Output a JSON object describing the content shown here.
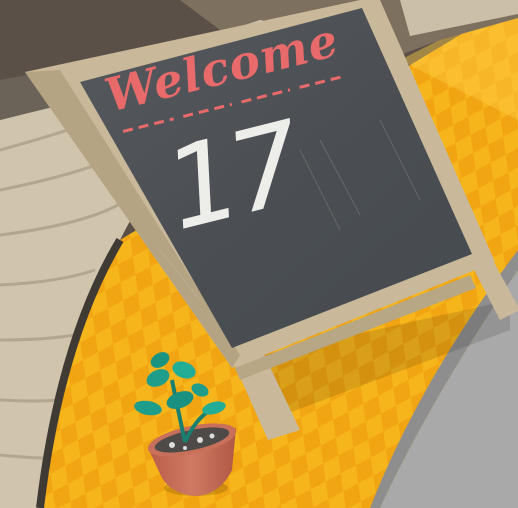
{
  "sign": {
    "heading": "Welcome",
    "number": "17"
  },
  "colors": {
    "floor_yellow": "#f7b51c",
    "floor_checker": "#f2a512",
    "floor_highlight": "#fcca45",
    "board_slate": "#4d5155",
    "board_frame": "#c9b99a",
    "chalk_red": "#e96a6a",
    "chalk_white": "#ededea",
    "plank": "#cfc3ad",
    "pot_terracotta": "#c8705a",
    "leaf_teal": "#1e9e8a"
  },
  "icons": {
    "plant": "potted-succulent-icon"
  }
}
